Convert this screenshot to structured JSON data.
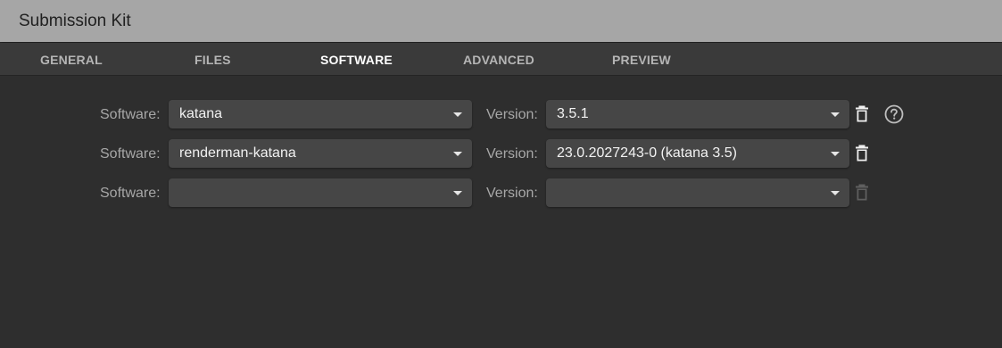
{
  "app": {
    "title": "Submission Kit"
  },
  "tabs": [
    {
      "label": "GENERAL",
      "active": false
    },
    {
      "label": "FILES",
      "active": false
    },
    {
      "label": "SOFTWARE",
      "active": true
    },
    {
      "label": "ADVANCED",
      "active": false
    },
    {
      "label": "PREVIEW",
      "active": false
    }
  ],
  "software": {
    "software_label": "Software:",
    "version_label": "Version:",
    "rows": [
      {
        "software": "katana",
        "version": "3.5.1",
        "delete_enabled": true,
        "help_icon": true
      },
      {
        "software": "renderman-katana",
        "version": "23.0.2027243-0 (katana 3.5)",
        "delete_enabled": true,
        "help_icon": false
      },
      {
        "software": "",
        "version": "",
        "delete_enabled": false,
        "help_icon": false
      }
    ]
  },
  "icons": {
    "delete": "trash-icon",
    "help": "help-circle-icon",
    "dropdown": "chevron-down-icon"
  },
  "colors": {
    "titlebar": "#a6a6a6",
    "tabbar": "#3a3a3a",
    "background": "#2e2e2e",
    "select": "#464646"
  }
}
